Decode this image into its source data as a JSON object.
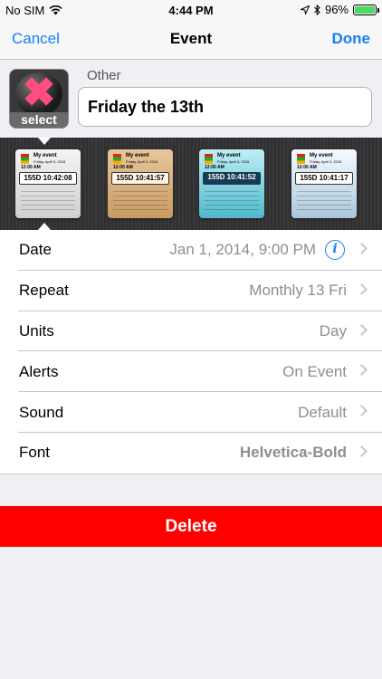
{
  "status_bar": {
    "carrier": "No SIM",
    "time": "4:44 PM",
    "battery": "96%"
  },
  "nav": {
    "cancel": "Cancel",
    "title": "Event",
    "done": "Done"
  },
  "header": {
    "thumbnail_label": "select",
    "category": "Other",
    "event_name": "Friday the 13th"
  },
  "themes": [
    {
      "title": "My event",
      "subtitle": "Friday, April 3, 2015",
      "time": "12:00 AM",
      "count": "155D 10:42:08"
    },
    {
      "title": "My event",
      "subtitle": "Friday, April 3, 2015",
      "time": "12:00 AM",
      "count": "155D 10:41:57"
    },
    {
      "title": "My event",
      "subtitle": "Friday, April 3, 2015",
      "time": "12:00 AM",
      "count": "155D 10:41:52"
    },
    {
      "title": "My event",
      "subtitle": "Friday, April 3, 2015",
      "time": "12:00 AM",
      "count": "155D 10:41:17"
    }
  ],
  "settings": [
    {
      "label": "Date",
      "value": "Jan 1, 2014, 9:00 PM"
    },
    {
      "label": "Repeat",
      "value": "Monthly 13 Fri"
    },
    {
      "label": "Units",
      "value": "Day"
    },
    {
      "label": "Alerts",
      "value": "On Event"
    },
    {
      "label": "Sound",
      "value": "Default"
    },
    {
      "label": "Font",
      "value": "Helvetica-Bold"
    }
  ],
  "delete_label": "Delete",
  "colors": {
    "accent": "#147efb",
    "delete": "#ff0000",
    "battery": "#4cd964"
  }
}
